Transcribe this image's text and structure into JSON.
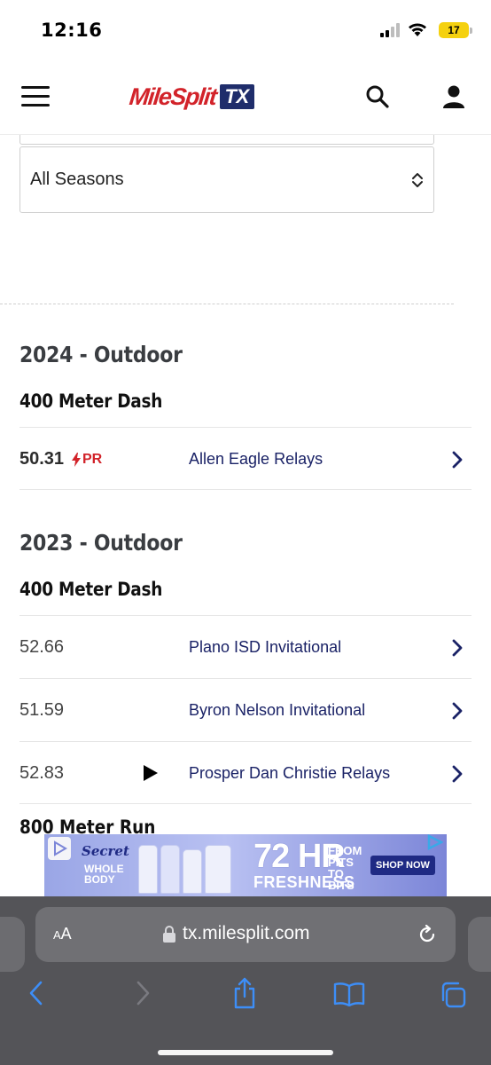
{
  "status_bar": {
    "time": "12:16",
    "battery_level": "17",
    "icons": [
      "signal-icon",
      "wifi-icon",
      "battery-icon"
    ]
  },
  "header": {
    "logo_text": "MileSplit",
    "logo_badge": "TX",
    "icons": [
      "menu-icon",
      "search-icon",
      "user-icon"
    ],
    "colors": {
      "brand_red": "#d2232a",
      "brand_navy": "#1f2d6b"
    }
  },
  "filters": {
    "season_select_value": "All Seasons"
  },
  "sections": [
    {
      "season": "2024 - Outdoor",
      "event": "400 Meter Dash",
      "results": [
        {
          "mark": "50.31",
          "pr_label": "PR",
          "meet": "Allen Eagle Relays",
          "has_video": false
        }
      ]
    },
    {
      "season": "2023 - Outdoor",
      "event": "400 Meter Dash",
      "results": [
        {
          "mark": "52.66",
          "meet": "Plano ISD Invitational",
          "has_video": false
        },
        {
          "mark": "51.59",
          "meet": "Byron Nelson Invitational",
          "has_video": false
        },
        {
          "mark": "52.83",
          "meet": "Prosper Dan Christie Relays",
          "has_video": true
        }
      ]
    }
  ],
  "next_event_partial": "800 Meter Run",
  "ad": {
    "brand": "Secret",
    "sub_text": [
      "WHOLE",
      "BODY"
    ],
    "headline": "72 HR",
    "tagline": "FRESHNESS",
    "side_text": [
      "FROM",
      "PITS",
      "TO",
      "BITS"
    ],
    "cta": "SHOP NOW"
  },
  "browser": {
    "aa_label": "AA",
    "url": "tx.milesplit.com",
    "toolbar_icons": [
      "back-icon",
      "forward-icon",
      "share-icon",
      "bookmarks-icon",
      "tabs-icon"
    ]
  }
}
